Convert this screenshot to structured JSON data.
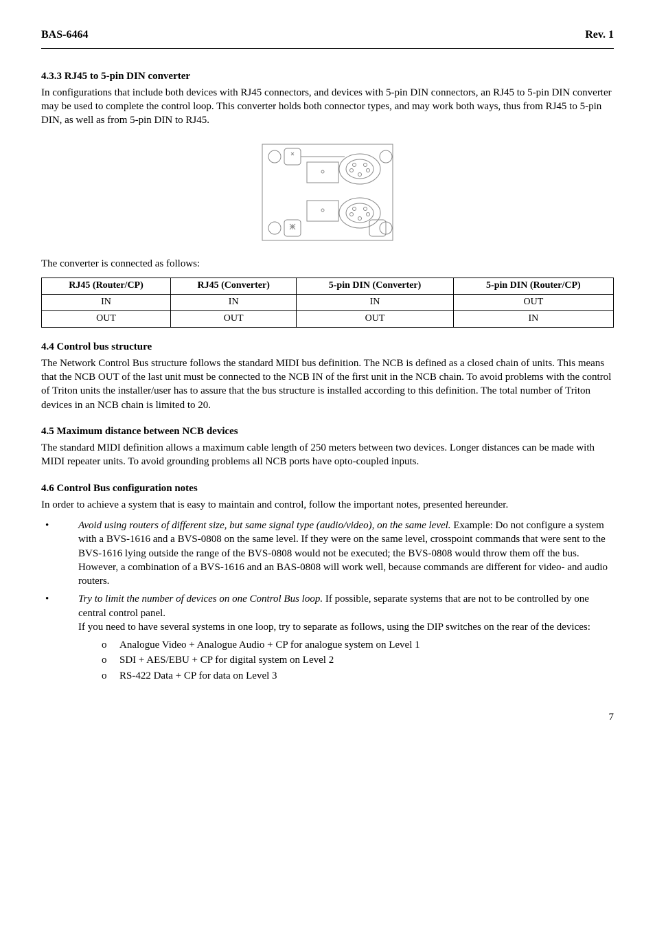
{
  "header": {
    "left": "BAS-6464",
    "right": "Rev. 1"
  },
  "s433": {
    "heading": "4.3.3   RJ45 to 5-pin DIN converter",
    "para": "In configurations that include both devices with RJ45 connectors, and devices with 5-pin DIN connectors, an RJ45 to 5-pin DIN converter may be used to complete the control loop. This converter holds both connector types, and may work both ways, thus from RJ45 to 5-pin DIN, as well as from 5-pin DIN to RJ45."
  },
  "tableIntro": "The converter is connected as follows:",
  "table": {
    "headers": [
      "RJ45 (Router/CP)",
      "RJ45 (Converter)",
      "5-pin DIN (Converter)",
      "5-pin DIN (Router/CP)"
    ],
    "rows": [
      [
        "IN",
        "IN",
        "IN",
        "OUT"
      ],
      [
        "OUT",
        "OUT",
        "OUT",
        "IN"
      ]
    ]
  },
  "s44": {
    "heading": "4.4   Control bus structure",
    "para": "The Network Control Bus structure follows the standard MIDI bus definition. The NCB is defined as a closed chain of units. This means that the NCB OUT of the last unit must be connected to the NCB IN of the first unit in the NCB chain. To avoid problems with the control of Triton units the installer/user has to assure that the bus structure is installed according to this definition. The total number of Triton devices in an NCB chain is limited to 20."
  },
  "s45": {
    "heading": "4.5   Maximum distance between NCB devices",
    "para": "The standard MIDI definition allows a maximum cable length of 250 meters between two devices. Longer distances can be made with MIDI repeater units. To avoid grounding problems all NCB ports have opto-coupled inputs."
  },
  "s46": {
    "heading": "4.6   Control Bus configuration notes",
    "para": "In order to achieve a system that is easy to maintain and control, follow the important notes, presented hereunder."
  },
  "bullets": {
    "b1": {
      "em": "Avoid using routers of different size, but same signal type (audio/video), on the same level.",
      "rest": " Example: Do not configure a system with a BVS-1616 and a BVS-0808 on the same level. If they were on the same level, crosspoint commands that were sent to the BVS-1616 lying outside the range of the BVS-0808 would not be executed; the BVS-0808 would throw them off the bus. However, a combination of a BVS-1616 and an BAS-0808 will work well, because commands are different for video- and audio routers."
    },
    "b2": {
      "em": "Try to limit the number of devices on one Control Bus loop.",
      "rest1": " If possible, separate systems that are not to be controlled by one central control panel.",
      "rest2": "If you need to have several systems in one loop, try to separate as follows, using the DIP switches on the rear of the devices:",
      "sub": [
        "Analogue Video + Analogue Audio + CP for analogue system on Level 1",
        "SDI + AES/EBU + CP for digital system on Level 2",
        "RS-422 Data + CP for data on Level 3"
      ]
    }
  },
  "pageNumber": "7"
}
